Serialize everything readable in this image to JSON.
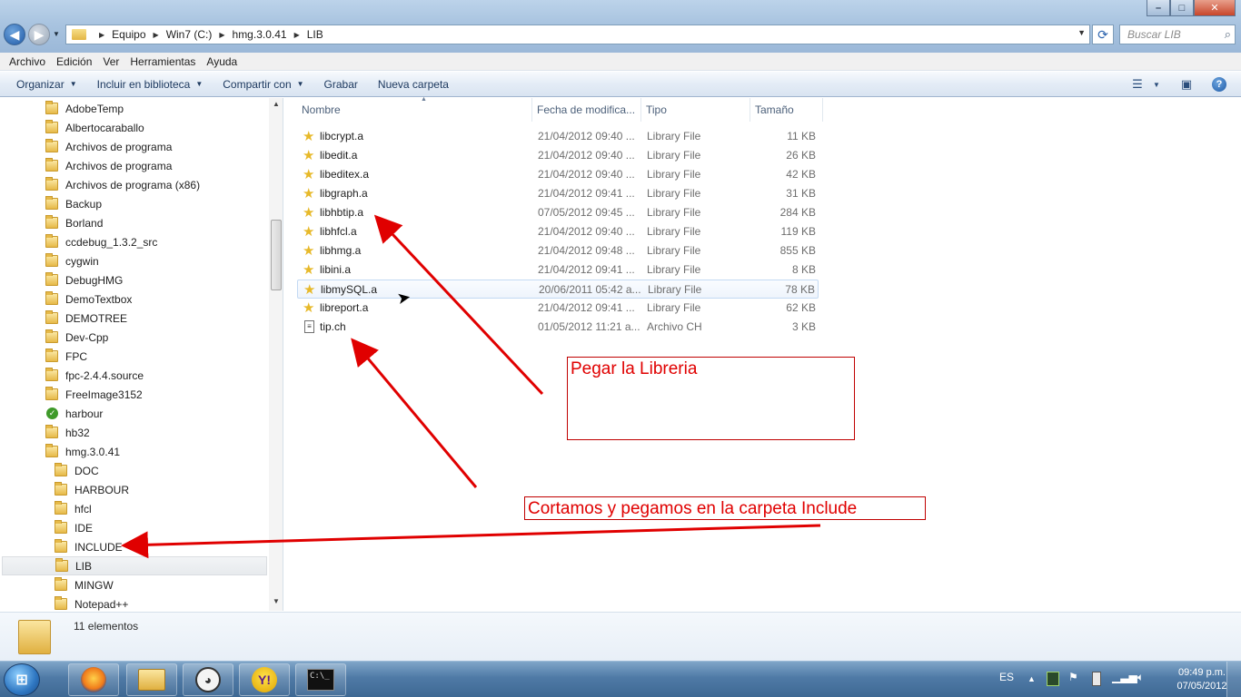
{
  "window": {
    "address_crumbs": [
      "Equipo",
      "Win7 (C:)",
      "hmg.3.0.41",
      "LIB"
    ],
    "search_placeholder": "Buscar LIB"
  },
  "menu": [
    "Archivo",
    "Edición",
    "Ver",
    "Herramientas",
    "Ayuda"
  ],
  "commands": {
    "organize": "Organizar",
    "include": "Incluir en biblioteca",
    "share": "Compartir con",
    "burn": "Grabar",
    "new_folder": "Nueva carpeta"
  },
  "tree": [
    {
      "label": "AdobeTemp",
      "icon": "folder"
    },
    {
      "label": "Albertocaraballo",
      "icon": "folder"
    },
    {
      "label": "Archivos de programa",
      "icon": "folder"
    },
    {
      "label": "Archivos de programa",
      "icon": "folder"
    },
    {
      "label": "Archivos de programa (x86)",
      "icon": "folder"
    },
    {
      "label": "Backup",
      "icon": "folder"
    },
    {
      "label": "Borland",
      "icon": "folder"
    },
    {
      "label": "ccdebug_1.3.2_src",
      "icon": "folder"
    },
    {
      "label": "cygwin",
      "icon": "folder"
    },
    {
      "label": "DebugHMG",
      "icon": "folder"
    },
    {
      "label": "DemoTextbox",
      "icon": "folder"
    },
    {
      "label": "DEMOTREE",
      "icon": "folder"
    },
    {
      "label": "Dev-Cpp",
      "icon": "folder"
    },
    {
      "label": "FPC",
      "icon": "folder"
    },
    {
      "label": "fpc-2.4.4.source",
      "icon": "folder"
    },
    {
      "label": "FreeImage3152",
      "icon": "folder"
    },
    {
      "label": "harbour",
      "icon": "check"
    },
    {
      "label": "hb32",
      "icon": "folder"
    },
    {
      "label": "hmg.3.0.41",
      "icon": "folder"
    },
    {
      "label": "DOC",
      "icon": "folder"
    },
    {
      "label": "HARBOUR",
      "icon": "folder"
    },
    {
      "label": "hfcl",
      "icon": "folder"
    },
    {
      "label": "IDE",
      "icon": "folder"
    },
    {
      "label": "INCLUDE",
      "icon": "folder"
    },
    {
      "label": "LIB",
      "icon": "folder",
      "selected": true
    },
    {
      "label": "MINGW",
      "icon": "folder"
    },
    {
      "label": "Notepad++",
      "icon": "folder"
    }
  ],
  "columns": {
    "name": "Nombre",
    "date": "Fecha de modifica...",
    "type": "Tipo",
    "size": "Tamaño"
  },
  "files": [
    {
      "name": "libcrypt.a",
      "date": "21/04/2012 09:40 ...",
      "type": "Library File",
      "size": "11 KB",
      "icon": "library"
    },
    {
      "name": "libedit.a",
      "date": "21/04/2012 09:40 ...",
      "type": "Library File",
      "size": "26 KB",
      "icon": "library"
    },
    {
      "name": "libeditex.a",
      "date": "21/04/2012 09:40 ...",
      "type": "Library File",
      "size": "42 KB",
      "icon": "library"
    },
    {
      "name": "libgraph.a",
      "date": "21/04/2012 09:41 ...",
      "type": "Library File",
      "size": "31 KB",
      "icon": "library"
    },
    {
      "name": "libhbtip.a",
      "date": "07/05/2012 09:45 ...",
      "type": "Library File",
      "size": "284 KB",
      "icon": "library"
    },
    {
      "name": "libhfcl.a",
      "date": "21/04/2012 09:40 ...",
      "type": "Library File",
      "size": "119 KB",
      "icon": "library"
    },
    {
      "name": "libhmg.a",
      "date": "21/04/2012 09:48 ...",
      "type": "Library File",
      "size": "855 KB",
      "icon": "library"
    },
    {
      "name": "libini.a",
      "date": "21/04/2012 09:41 ...",
      "type": "Library File",
      "size": "8 KB",
      "icon": "library"
    },
    {
      "name": "libmySQL.a",
      "date": "20/06/2011 05:42 a...",
      "type": "Library File",
      "size": "78 KB",
      "icon": "library",
      "hover": true
    },
    {
      "name": "libreport.a",
      "date": "21/04/2012 09:41 ...",
      "type": "Library File",
      "size": "62 KB",
      "icon": "library"
    },
    {
      "name": "tip.ch",
      "date": "01/05/2012 11:21 a...",
      "type": "Archivo CH",
      "size": "3 KB",
      "icon": "ch-file"
    }
  ],
  "annotations": {
    "paste_library": "Pegar la Libreria",
    "cut_paste_include": "Cortamos y pegamos en  la carpeta Include",
    "arrow_color": "#e00000"
  },
  "details": {
    "count": "11 elementos"
  },
  "taskbar": {
    "lang": "ES",
    "time": "09:49 p.m.",
    "date": "07/05/2012",
    "apps": [
      "firefox-icon",
      "explorer-icon",
      "dog-icon",
      "yahoo-messenger-icon",
      "cmd-icon"
    ]
  }
}
